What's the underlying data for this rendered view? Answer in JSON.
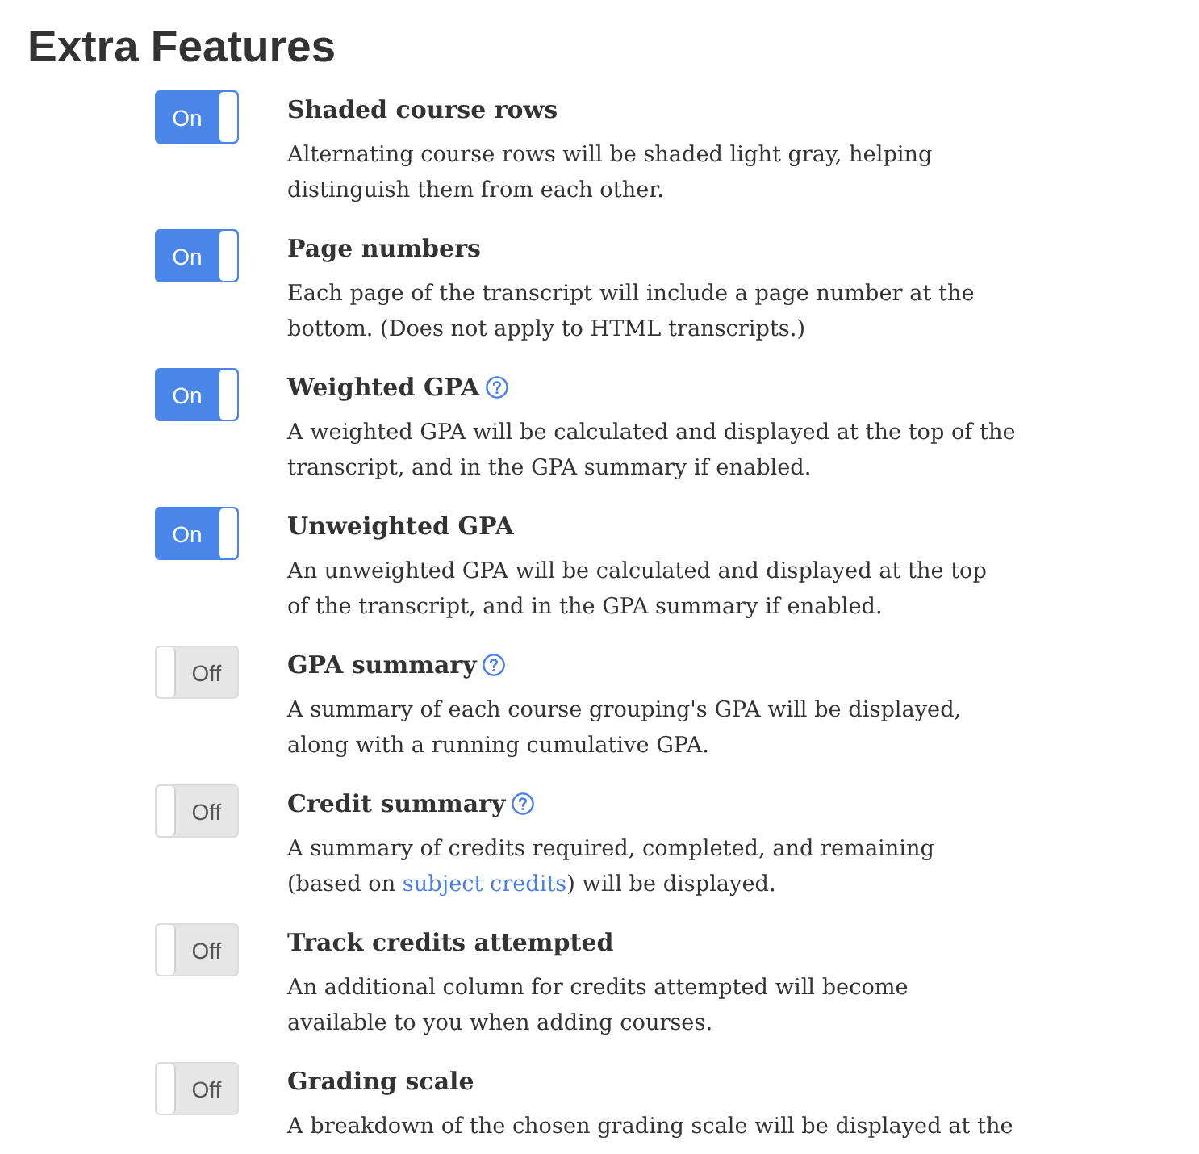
{
  "heading": "Extra Features",
  "features": [
    {
      "title": "Shaded course rows",
      "on": true,
      "toggle_label": "On",
      "help": false,
      "description": [
        {
          "kind": "text",
          "text": "Alternating course rows will be shaded light gray, helping\ndistinguish them from each other."
        }
      ]
    },
    {
      "title": "Page numbers",
      "on": true,
      "toggle_label": "On",
      "help": false,
      "description": [
        {
          "kind": "text",
          "text": "Each page of the transcript will include a page number at the\nbottom. (Does not apply to HTML transcripts.)"
        }
      ]
    },
    {
      "title": "Weighted GPA",
      "on": true,
      "toggle_label": "On",
      "help": true,
      "description": [
        {
          "kind": "text",
          "text": "A weighted GPA will be calculated and displayed at the top of the\ntranscript, and in the GPA summary if enabled."
        }
      ]
    },
    {
      "title": "Unweighted GPA",
      "on": true,
      "toggle_label": "On",
      "help": false,
      "description": [
        {
          "kind": "text",
          "text": "An unweighted GPA will be calculated and displayed at the top\nof the transcript, and in the GPA summary if enabled."
        }
      ]
    },
    {
      "title": "GPA summary",
      "on": false,
      "toggle_label": "Off",
      "help": true,
      "description": [
        {
          "kind": "text",
          "text": "A summary of each course grouping's GPA will be displayed,\nalong with a running cumulative GPA."
        }
      ]
    },
    {
      "title": "Credit summary",
      "on": false,
      "toggle_label": "Off",
      "help": true,
      "description": [
        {
          "kind": "text",
          "text": "A summary of credits required, completed, and remaining\n(based on "
        },
        {
          "kind": "link",
          "text": "subject credits"
        },
        {
          "kind": "text",
          "text": ") will be displayed."
        }
      ]
    },
    {
      "title": "Track credits attempted",
      "on": false,
      "toggle_label": "Off",
      "help": false,
      "description": [
        {
          "kind": "text",
          "text": "An additional column for credits attempted will become\navailable to you when adding courses."
        }
      ]
    },
    {
      "title": "Grading scale",
      "on": false,
      "toggle_label": "Off",
      "help": false,
      "description": [
        {
          "kind": "text",
          "text": "A breakdown of the chosen grading scale will be displayed at the"
        }
      ]
    }
  ]
}
